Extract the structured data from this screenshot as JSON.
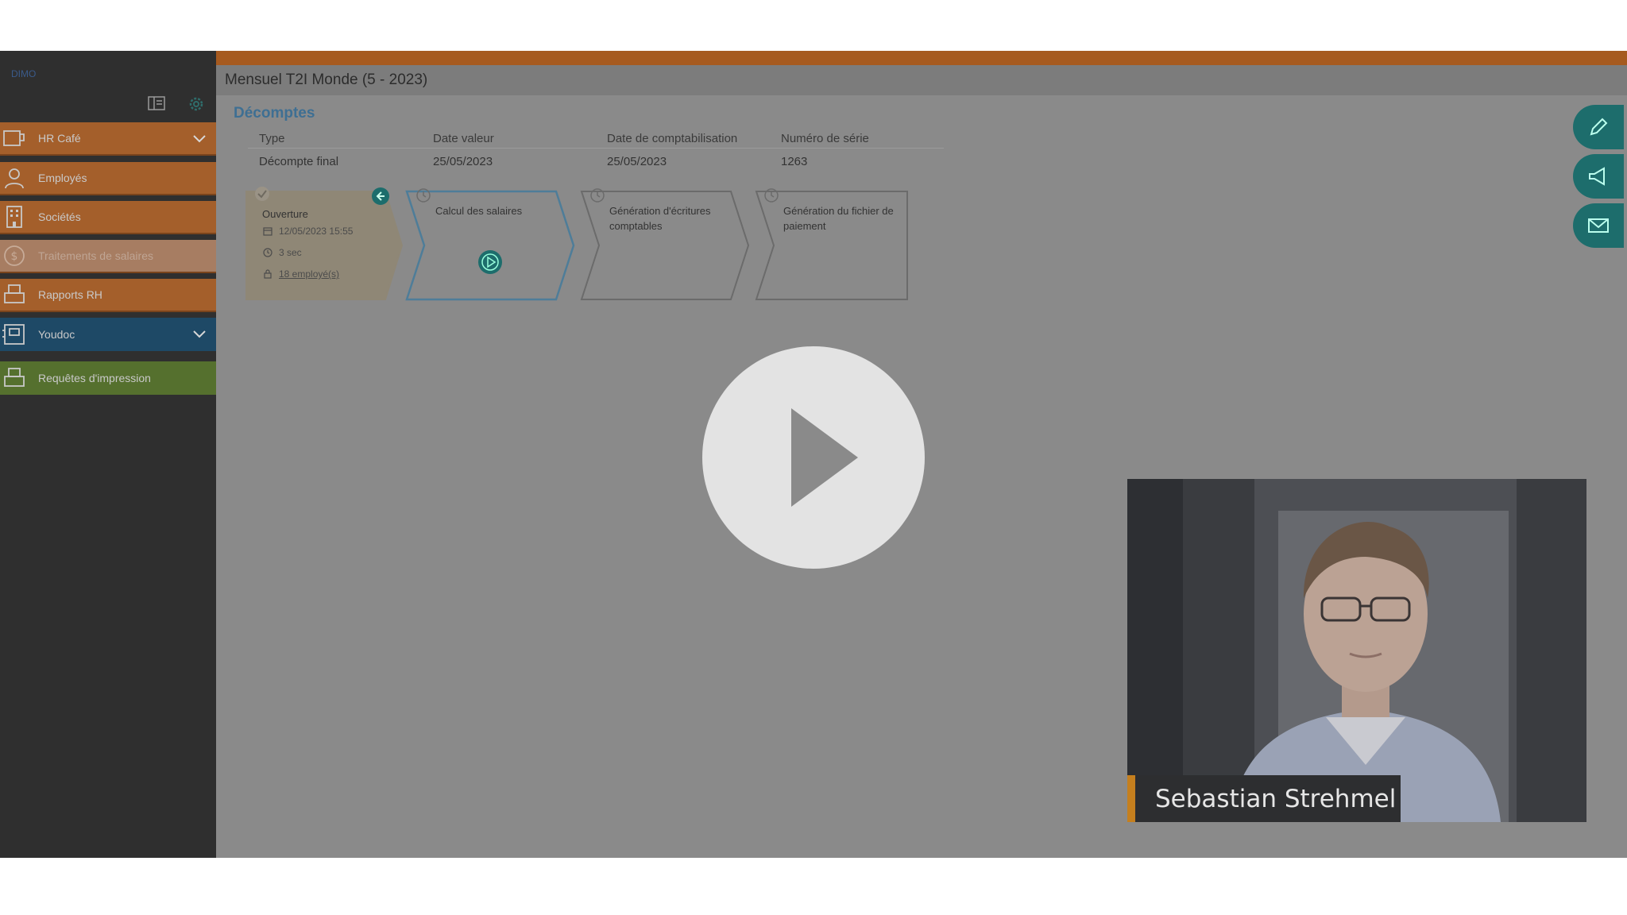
{
  "sidebar": {
    "brand": "DIMO",
    "items": [
      {
        "label": "HR Café",
        "icon": "coffee-icon"
      },
      {
        "label": "Employés",
        "icon": "user-icon"
      },
      {
        "label": "Sociétés",
        "icon": "building-icon"
      },
      {
        "label": "Traitements de salaires",
        "icon": "dollar-icon"
      },
      {
        "label": "Rapports RH",
        "icon": "printer-icon"
      },
      {
        "label": "Youdoc",
        "icon": "document-icon"
      },
      {
        "label": "Requêtes d'impression",
        "icon": "printer-icon"
      }
    ]
  },
  "page": {
    "title": "Mensuel T2I Monde (5 - 2023)",
    "section": "Décomptes"
  },
  "table": {
    "columns": [
      "Type",
      "Date valeur",
      "Date de comptabilisation",
      "Numéro de série"
    ],
    "rows": [
      [
        "Décompte final",
        "25/05/2023",
        "25/05/2023",
        "1263"
      ]
    ]
  },
  "workflow": {
    "steps": [
      {
        "title": "Ouverture",
        "state": "completed"
      },
      {
        "title": "Calcul des salaires",
        "state": "active"
      },
      {
        "title": "Génération d'écritures comptables",
        "state": "pending"
      },
      {
        "title": "Génération du fichier de paiement",
        "state": "pending"
      }
    ],
    "opening": {
      "datetime": "12/05/2023 15:55",
      "duration": "3 sec",
      "employees": "18 employé(s)"
    }
  },
  "overlay": {
    "presenter_name": "Sebastian Strehmel"
  },
  "colors": {
    "accent_orange": "#a65a1f",
    "teal": "#1d6d6c",
    "link_blue": "#3e6f93"
  }
}
